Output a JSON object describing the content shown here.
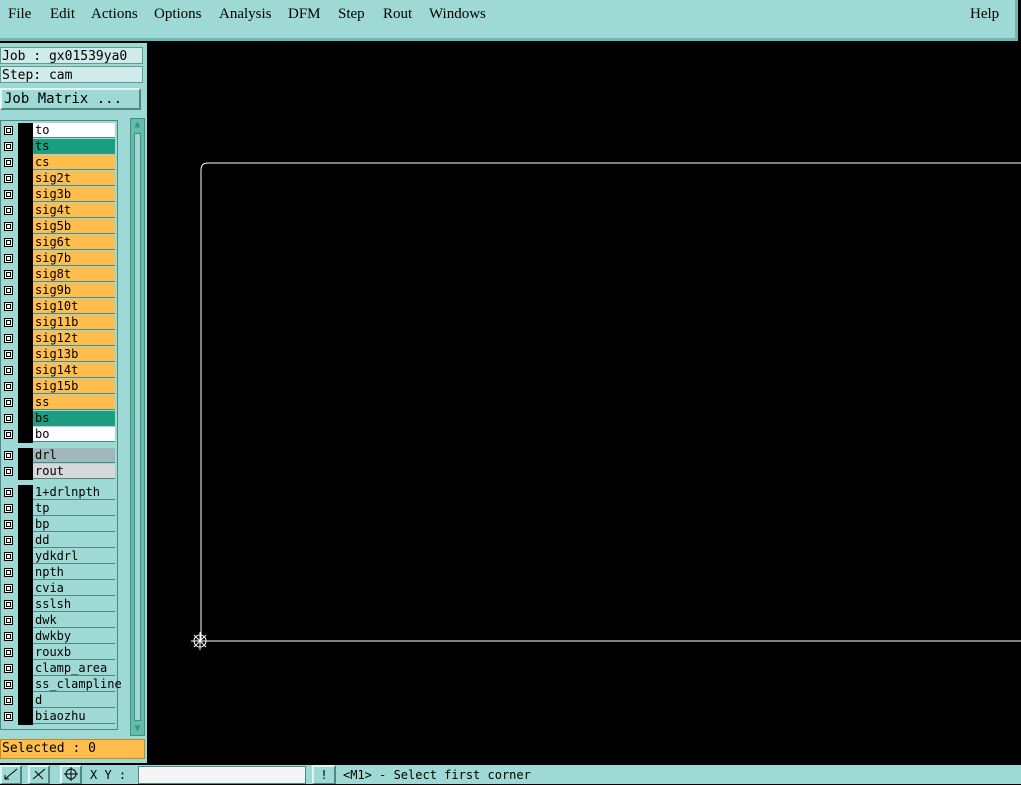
{
  "menu": {
    "file": "File",
    "edit": "Edit",
    "actions": "Actions",
    "options": "Options",
    "analysis": "Analysis",
    "dfm": "DFM",
    "step": "Step",
    "rout": "Rout",
    "windows": "Windows",
    "help": "Help"
  },
  "panel": {
    "job": "Job : gx01539ya0",
    "step": "Step: cam",
    "job_matrix_button": "Job Matrix ...",
    "selected": "Selected : 0"
  },
  "layers": [
    {
      "name": "to",
      "color": "#ffffff"
    },
    {
      "name": "ts",
      "color": "#1a9e80"
    },
    {
      "name": "cs",
      "color": "#ffbe4c"
    },
    {
      "name": "sig2t",
      "color": "#ffbe4c"
    },
    {
      "name": "sig3b",
      "color": "#ffbe4c"
    },
    {
      "name": "sig4t",
      "color": "#ffbe4c"
    },
    {
      "name": "sig5b",
      "color": "#ffbe4c"
    },
    {
      "name": "sig6t",
      "color": "#ffbe4c"
    },
    {
      "name": "sig7b",
      "color": "#ffbe4c"
    },
    {
      "name": "sig8t",
      "color": "#ffbe4c"
    },
    {
      "name": "sig9b",
      "color": "#ffbe4c"
    },
    {
      "name": "sig10t",
      "color": "#ffbe4c"
    },
    {
      "name": "sig11b",
      "color": "#ffbe4c"
    },
    {
      "name": "sig12t",
      "color": "#ffbe4c"
    },
    {
      "name": "sig13b",
      "color": "#ffbe4c"
    },
    {
      "name": "sig14t",
      "color": "#ffbe4c"
    },
    {
      "name": "sig15b",
      "color": "#ffbe4c"
    },
    {
      "name": "ss",
      "color": "#ffbe4c"
    },
    {
      "name": "bs",
      "color": "#1a9e80"
    },
    {
      "name": "bo",
      "color": "#ffffff"
    },
    {
      "name": "drl",
      "color": "#a0b8bc"
    },
    {
      "name": "rout",
      "color": "#d8d8d8"
    },
    {
      "name": "1+drlnpth",
      "color": "#9fd9d6"
    },
    {
      "name": "tp",
      "color": "#9fd9d6"
    },
    {
      "name": "bp",
      "color": "#9fd9d6"
    },
    {
      "name": "dd",
      "color": "#9fd9d6"
    },
    {
      "name": "ydkdrl",
      "color": "#9fd9d6"
    },
    {
      "name": "npth",
      "color": "#9fd9d6"
    },
    {
      "name": "cvia",
      "color": "#9fd9d6"
    },
    {
      "name": "sslsh",
      "color": "#9fd9d6"
    },
    {
      "name": "dwk",
      "color": "#9fd9d6"
    },
    {
      "name": "dwkby",
      "color": "#9fd9d6"
    },
    {
      "name": "rouxb",
      "color": "#9fd9d6"
    },
    {
      "name": "clamp_area",
      "color": "#9fd9d6"
    },
    {
      "name": "ss_clampline",
      "color": "#9fd9d6"
    },
    {
      "name": "d",
      "color": "#9fd9d6"
    },
    {
      "name": "biaozhu",
      "color": "#9fd9d6"
    }
  ],
  "status": {
    "xy_label": "X Y :",
    "xy_value": "",
    "message": "<M1> - Select first corner"
  },
  "icons": {
    "scroll_up": "triangle-up",
    "scroll_down": "triangle-down",
    "alert": "exclamation"
  }
}
